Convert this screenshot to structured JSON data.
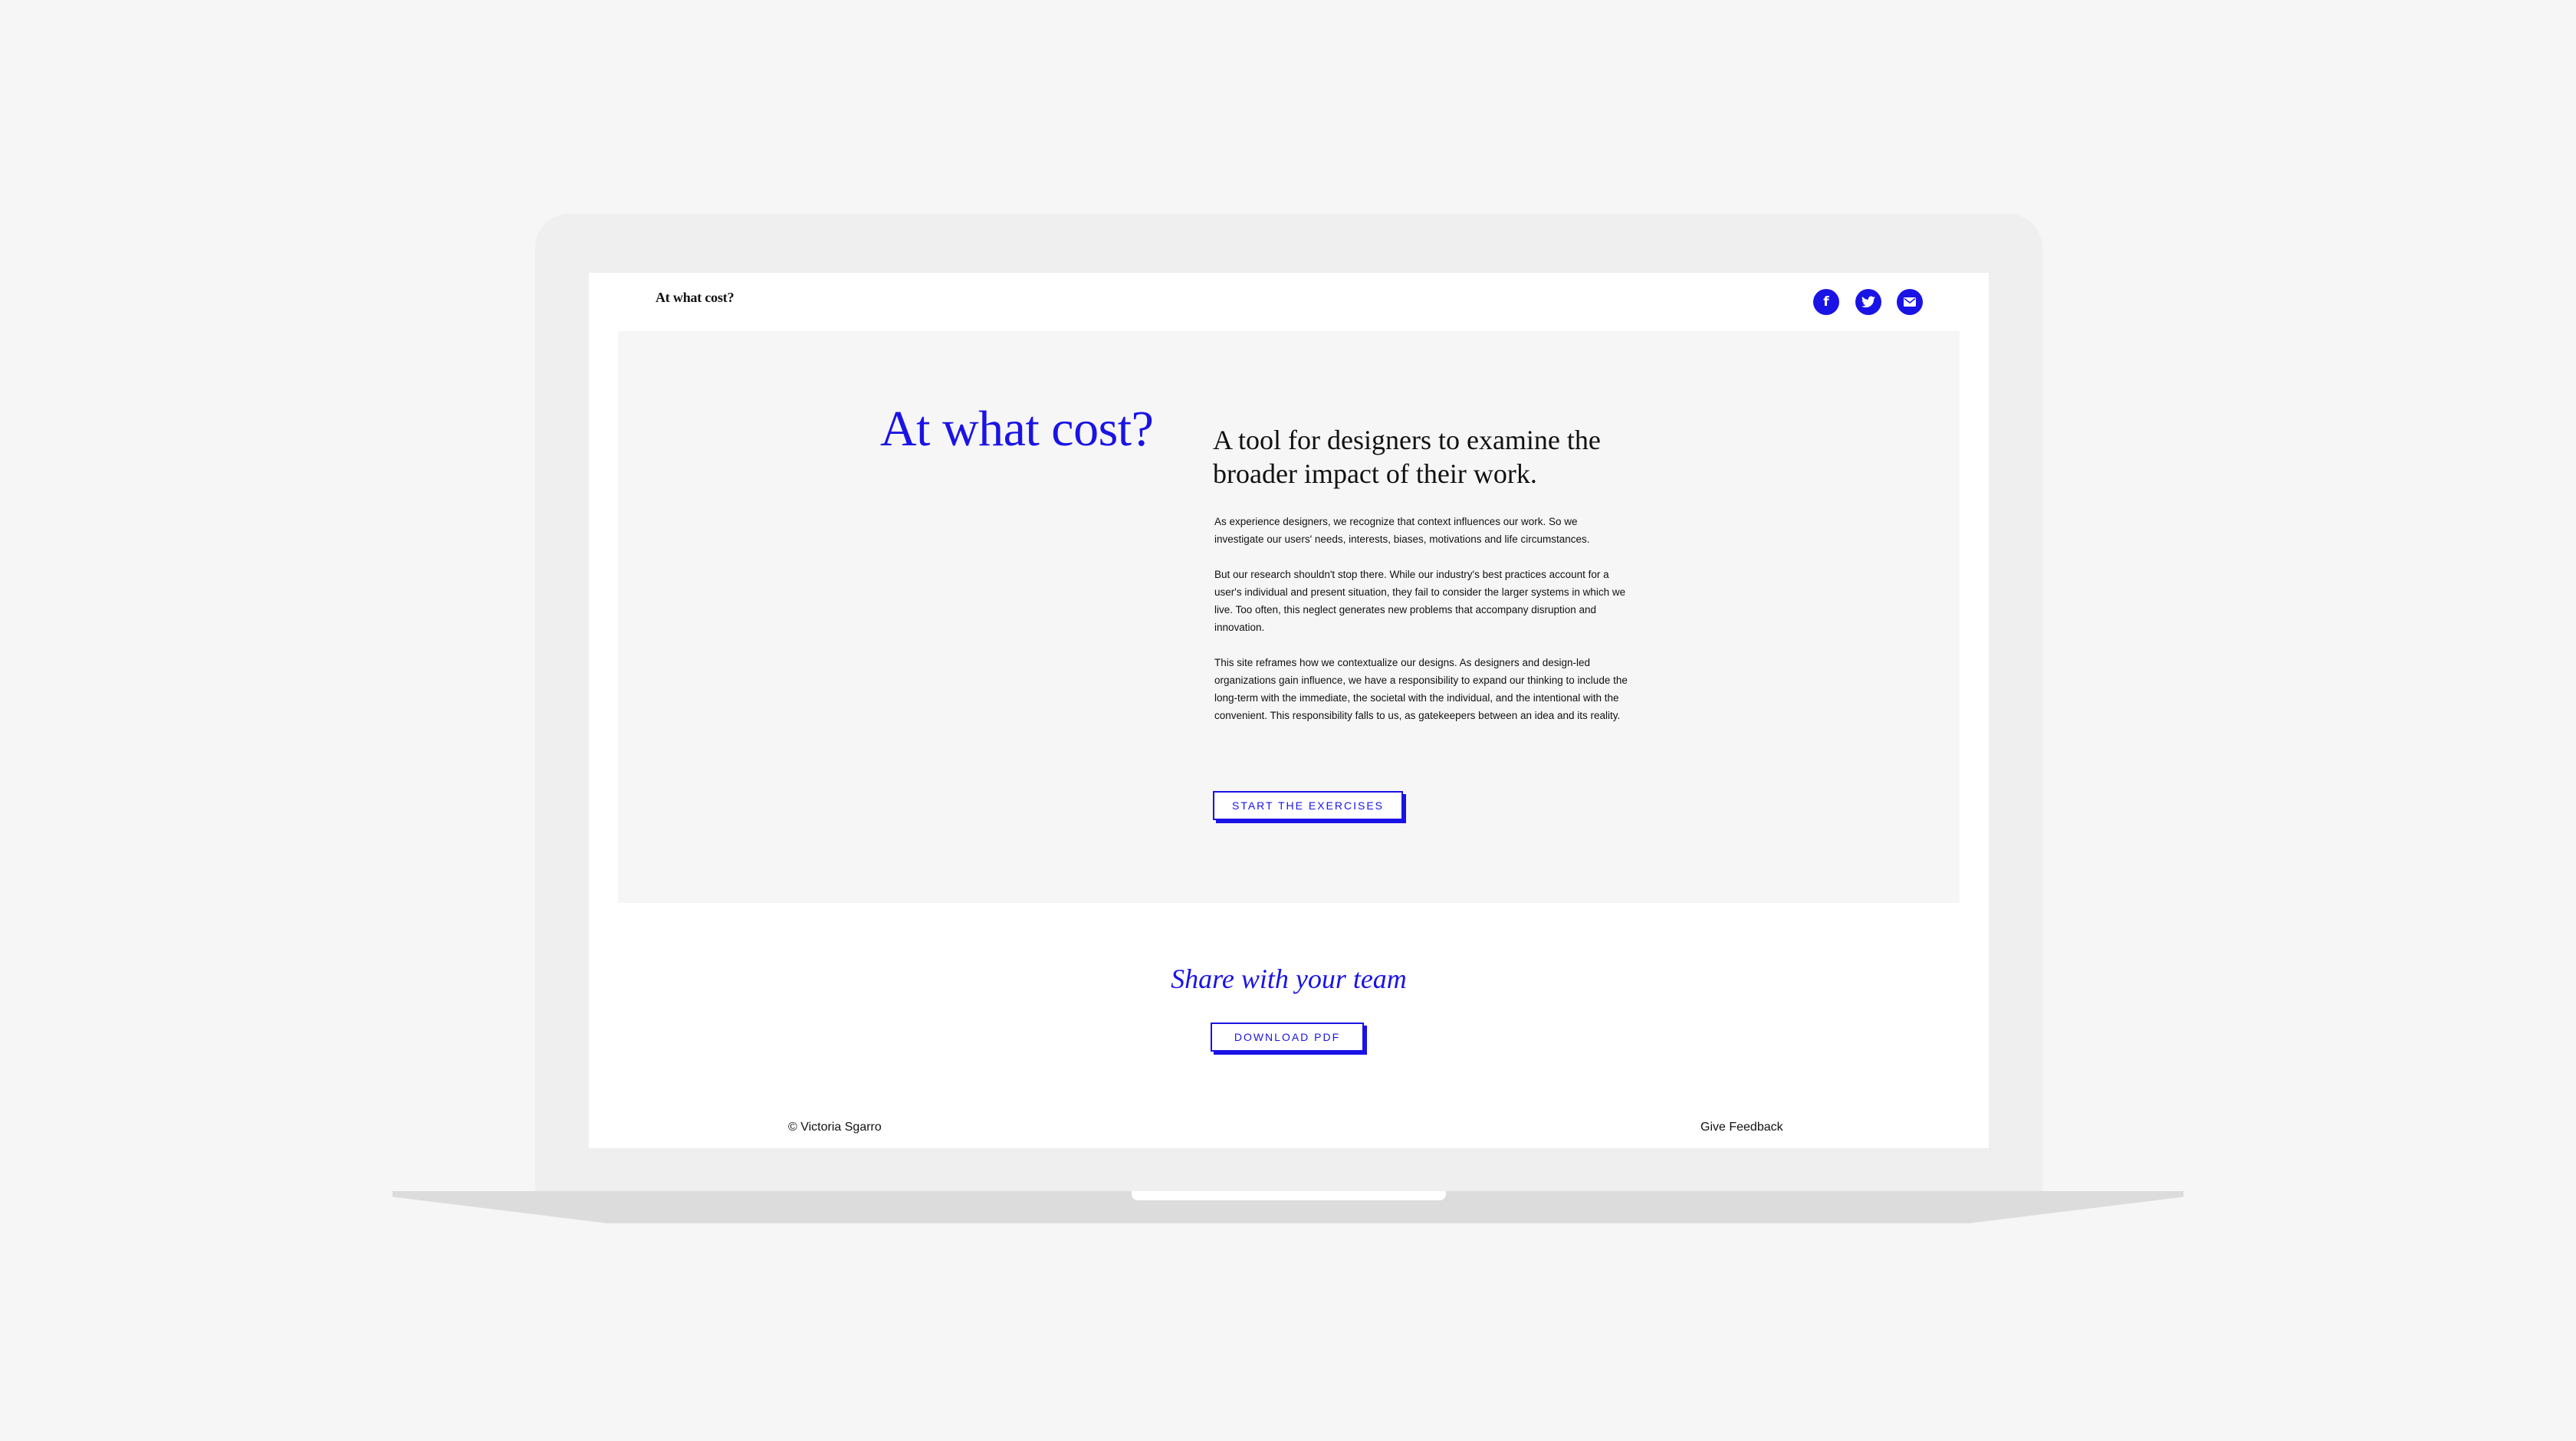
{
  "header": {
    "logo": "At what cost?",
    "social": {
      "facebook_icon": "f",
      "twitter_icon": "twitter-bird",
      "email_icon": "envelope"
    }
  },
  "hero": {
    "title": "At what cost?",
    "subtitle": "A tool for designers to examine the broader impact of their work.",
    "paragraphs": [
      "As experience designers, we recognize that context influences our work. So we investigate our users' needs, interests, biases, motivations and life circumstances.",
      "But our research shouldn't stop there. While our industry's best practices account for a user's individual and present situation, they fail to consider the larger systems in which we live. Too often, this neglect generates new problems that accompany disruption and innovation.",
      "This site reframes how we contextualize our designs. As designers and design-led organizations gain influence, we have a responsibility to expand our thinking to include the long-term with the immediate, the societal with the individual, and the intentional with the convenient. This responsibility falls to us, as gatekeepers between an idea and its reality."
    ],
    "cta_label": "START THE EXERCISES"
  },
  "share": {
    "title": "Share with your team",
    "download_label": "DOWNLOAD PDF"
  },
  "footer": {
    "copyright": "© Victoria Sgarro",
    "feedback": "Give Feedback"
  },
  "colors": {
    "accent": "#1a13e6",
    "text": "#111111",
    "background": "#f6f6f6",
    "laptop": "#efefef"
  }
}
